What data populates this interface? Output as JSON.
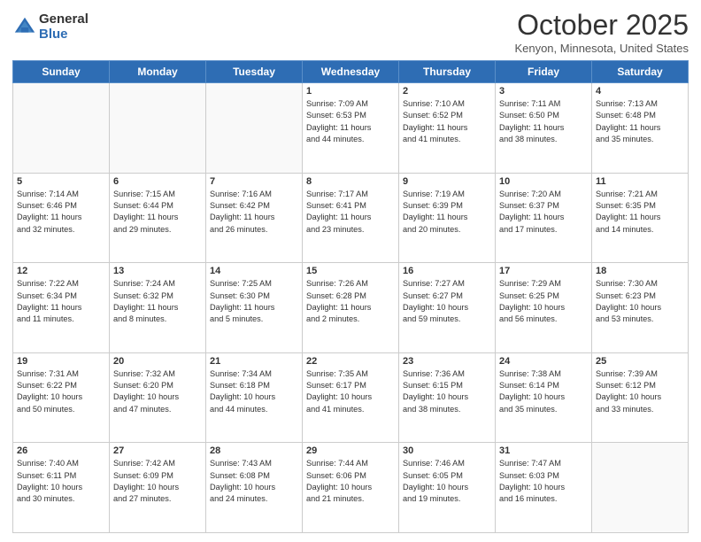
{
  "logo": {
    "general": "General",
    "blue": "Blue"
  },
  "header": {
    "month": "October 2025",
    "location": "Kenyon, Minnesota, United States"
  },
  "weekdays": [
    "Sunday",
    "Monday",
    "Tuesday",
    "Wednesday",
    "Thursday",
    "Friday",
    "Saturday"
  ],
  "weeks": [
    [
      {
        "day": "",
        "info": ""
      },
      {
        "day": "",
        "info": ""
      },
      {
        "day": "",
        "info": ""
      },
      {
        "day": "1",
        "info": "Sunrise: 7:09 AM\nSunset: 6:53 PM\nDaylight: 11 hours\nand 44 minutes."
      },
      {
        "day": "2",
        "info": "Sunrise: 7:10 AM\nSunset: 6:52 PM\nDaylight: 11 hours\nand 41 minutes."
      },
      {
        "day": "3",
        "info": "Sunrise: 7:11 AM\nSunset: 6:50 PM\nDaylight: 11 hours\nand 38 minutes."
      },
      {
        "day": "4",
        "info": "Sunrise: 7:13 AM\nSunset: 6:48 PM\nDaylight: 11 hours\nand 35 minutes."
      }
    ],
    [
      {
        "day": "5",
        "info": "Sunrise: 7:14 AM\nSunset: 6:46 PM\nDaylight: 11 hours\nand 32 minutes."
      },
      {
        "day": "6",
        "info": "Sunrise: 7:15 AM\nSunset: 6:44 PM\nDaylight: 11 hours\nand 29 minutes."
      },
      {
        "day": "7",
        "info": "Sunrise: 7:16 AM\nSunset: 6:42 PM\nDaylight: 11 hours\nand 26 minutes."
      },
      {
        "day": "8",
        "info": "Sunrise: 7:17 AM\nSunset: 6:41 PM\nDaylight: 11 hours\nand 23 minutes."
      },
      {
        "day": "9",
        "info": "Sunrise: 7:19 AM\nSunset: 6:39 PM\nDaylight: 11 hours\nand 20 minutes."
      },
      {
        "day": "10",
        "info": "Sunrise: 7:20 AM\nSunset: 6:37 PM\nDaylight: 11 hours\nand 17 minutes."
      },
      {
        "day": "11",
        "info": "Sunrise: 7:21 AM\nSunset: 6:35 PM\nDaylight: 11 hours\nand 14 minutes."
      }
    ],
    [
      {
        "day": "12",
        "info": "Sunrise: 7:22 AM\nSunset: 6:34 PM\nDaylight: 11 hours\nand 11 minutes."
      },
      {
        "day": "13",
        "info": "Sunrise: 7:24 AM\nSunset: 6:32 PM\nDaylight: 11 hours\nand 8 minutes."
      },
      {
        "day": "14",
        "info": "Sunrise: 7:25 AM\nSunset: 6:30 PM\nDaylight: 11 hours\nand 5 minutes."
      },
      {
        "day": "15",
        "info": "Sunrise: 7:26 AM\nSunset: 6:28 PM\nDaylight: 11 hours\nand 2 minutes."
      },
      {
        "day": "16",
        "info": "Sunrise: 7:27 AM\nSunset: 6:27 PM\nDaylight: 10 hours\nand 59 minutes."
      },
      {
        "day": "17",
        "info": "Sunrise: 7:29 AM\nSunset: 6:25 PM\nDaylight: 10 hours\nand 56 minutes."
      },
      {
        "day": "18",
        "info": "Sunrise: 7:30 AM\nSunset: 6:23 PM\nDaylight: 10 hours\nand 53 minutes."
      }
    ],
    [
      {
        "day": "19",
        "info": "Sunrise: 7:31 AM\nSunset: 6:22 PM\nDaylight: 10 hours\nand 50 minutes."
      },
      {
        "day": "20",
        "info": "Sunrise: 7:32 AM\nSunset: 6:20 PM\nDaylight: 10 hours\nand 47 minutes."
      },
      {
        "day": "21",
        "info": "Sunrise: 7:34 AM\nSunset: 6:18 PM\nDaylight: 10 hours\nand 44 minutes."
      },
      {
        "day": "22",
        "info": "Sunrise: 7:35 AM\nSunset: 6:17 PM\nDaylight: 10 hours\nand 41 minutes."
      },
      {
        "day": "23",
        "info": "Sunrise: 7:36 AM\nSunset: 6:15 PM\nDaylight: 10 hours\nand 38 minutes."
      },
      {
        "day": "24",
        "info": "Sunrise: 7:38 AM\nSunset: 6:14 PM\nDaylight: 10 hours\nand 35 minutes."
      },
      {
        "day": "25",
        "info": "Sunrise: 7:39 AM\nSunset: 6:12 PM\nDaylight: 10 hours\nand 33 minutes."
      }
    ],
    [
      {
        "day": "26",
        "info": "Sunrise: 7:40 AM\nSunset: 6:11 PM\nDaylight: 10 hours\nand 30 minutes."
      },
      {
        "day": "27",
        "info": "Sunrise: 7:42 AM\nSunset: 6:09 PM\nDaylight: 10 hours\nand 27 minutes."
      },
      {
        "day": "28",
        "info": "Sunrise: 7:43 AM\nSunset: 6:08 PM\nDaylight: 10 hours\nand 24 minutes."
      },
      {
        "day": "29",
        "info": "Sunrise: 7:44 AM\nSunset: 6:06 PM\nDaylight: 10 hours\nand 21 minutes."
      },
      {
        "day": "30",
        "info": "Sunrise: 7:46 AM\nSunset: 6:05 PM\nDaylight: 10 hours\nand 19 minutes."
      },
      {
        "day": "31",
        "info": "Sunrise: 7:47 AM\nSunset: 6:03 PM\nDaylight: 10 hours\nand 16 minutes."
      },
      {
        "day": "",
        "info": ""
      }
    ]
  ]
}
